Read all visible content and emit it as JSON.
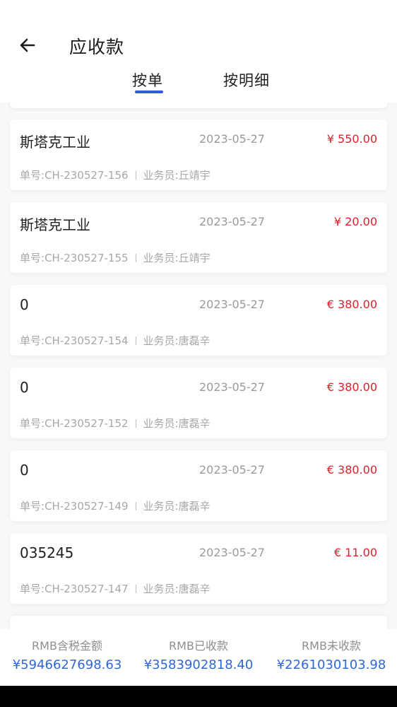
{
  "header": {
    "title": "应收款",
    "tabs": [
      {
        "label": "按单",
        "active": true
      },
      {
        "label": "按明细",
        "active": false
      }
    ]
  },
  "labels": {
    "order_prefix": "单号:",
    "salesperson_prefix": "业务员:"
  },
  "records": [
    {
      "name": "斯塔克工业",
      "date": "2023-05-27",
      "amount": "¥ 550.00",
      "order_no": "CH-230527-156",
      "salesperson": "丘靖宇"
    },
    {
      "name": "斯塔克工业",
      "date": "2023-05-27",
      "amount": "¥ 20.00",
      "order_no": "CH-230527-155",
      "salesperson": "丘靖宇"
    },
    {
      "name": "0",
      "date": "2023-05-27",
      "amount": "€ 380.00",
      "order_no": "CH-230527-154",
      "salesperson": "唐磊辛"
    },
    {
      "name": "0",
      "date": "2023-05-27",
      "amount": "€ 380.00",
      "order_no": "CH-230527-152",
      "salesperson": "唐磊辛"
    },
    {
      "name": "0",
      "date": "2023-05-27",
      "amount": "€ 380.00",
      "order_no": "CH-230527-149",
      "salesperson": "唐磊辛"
    },
    {
      "name": "035245",
      "date": "2023-05-27",
      "amount": "€ 11.00",
      "order_no": "CH-230527-147",
      "salesperson": "唐磊辛"
    }
  ],
  "summary": {
    "total_tax_label": "RMB含税金额",
    "total_tax_value": "¥5946627698.63",
    "received_label": "RMB已收款",
    "received_value": "¥3583902818.40",
    "unreceived_label": "RMB未收款",
    "unreceived_value": "¥2261030103.98"
  },
  "colors": {
    "accent": "#2f5bd8",
    "amount": "#e01f2a",
    "summary_value": "#2f67d8"
  }
}
